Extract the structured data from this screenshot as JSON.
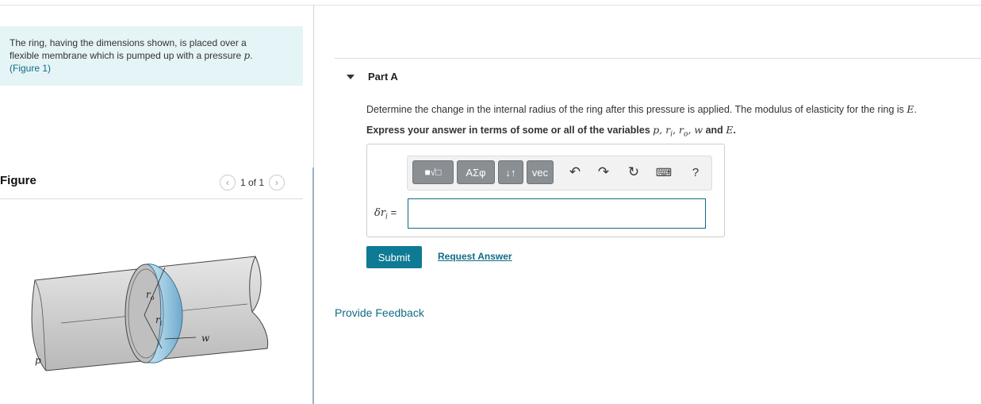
{
  "problem": {
    "text_line1": "The ring, having the dimensions shown, is placed over a",
    "text_line2": "flexible membrane which is pumped up with a pressure",
    "var_p": "p",
    "period": ".",
    "figure_link": "(Figure 1)"
  },
  "figure_panel": {
    "title": "Figure",
    "pager": "1 of 1",
    "labels": {
      "ro": "r",
      "ro_sub": "o",
      "ri": "r",
      "ri_sub": "i",
      "w": "w",
      "p": "p"
    }
  },
  "part": {
    "label": "Part A",
    "question": "Determine the change in the internal radius of the ring after this pressure is applied. The modulus of elasticity for the ring is",
    "question_var": "E",
    "question_end": ".",
    "instruct_prefix": "Express your answer in terms of some or all of the variables",
    "instruct_vars": "p, r",
    "instruct_i": "i",
    "instruct_mid": ", r",
    "instruct_o": "o",
    "instruct_w": ", w",
    "instruct_and": "and",
    "instruct_E": "E",
    "instruct_end": "."
  },
  "toolbar": {
    "templates_label": "■√□",
    "greek_label": "ΑΣφ",
    "arrows_label": "↓↑",
    "vec_label": "vec",
    "help_label": "?"
  },
  "answer": {
    "lhs_delta": "δr",
    "lhs_sub": "i",
    "lhs_eq": "=",
    "value": ""
  },
  "actions": {
    "submit_label": "Submit",
    "request_label": "Request Answer",
    "feedback_label": "Provide Feedback"
  },
  "colors": {
    "accent": "#0f7a93",
    "link": "#0f6c86",
    "problem_bg": "#e5f4f6",
    "ring": "#9fcbe3"
  }
}
